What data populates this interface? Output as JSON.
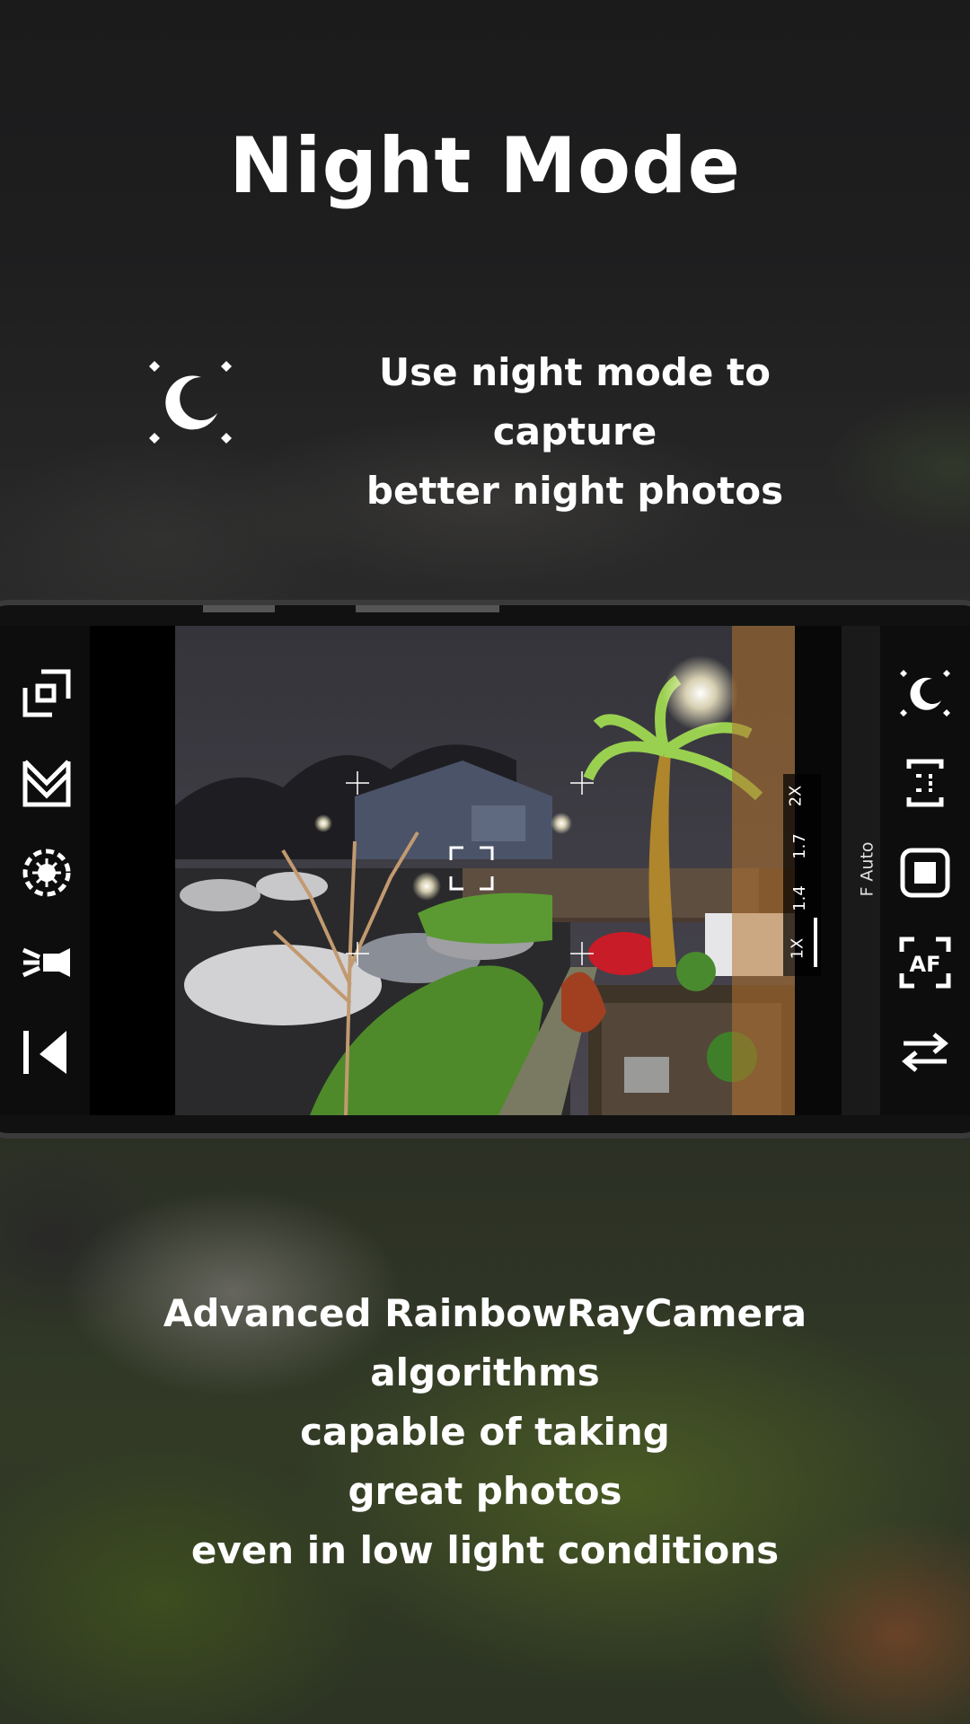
{
  "header": {
    "title": "Night Mode"
  },
  "feature": {
    "icon": "night-moon-sparkle-icon",
    "line1": "Use night mode to capture",
    "line2": "better night photos"
  },
  "camera": {
    "left_tools": [
      "aspect-crop-icon",
      "filter-mode-icon",
      "exposure-dial-icon",
      "flash-icon",
      "gallery-icon"
    ],
    "right_tools": [
      "night-mode-icon",
      "timer-bracket-icon",
      "shutter-button-icon",
      "autofocus-icon",
      "switch-camera-icon"
    ],
    "zoom_levels": [
      "2X",
      "1.7",
      "1.4",
      "1X"
    ],
    "focus_label": "F Auto",
    "focus_box_icon": "focus-frame-icon"
  },
  "description": {
    "lines": [
      "Advanced RainbowRayCamera",
      "algorithms",
      "capable of taking",
      "great photos",
      "even in low light conditions"
    ]
  },
  "colors": {
    "background": "#1b1b1c",
    "text": "#ffffff",
    "accent": "#ffffff"
  }
}
